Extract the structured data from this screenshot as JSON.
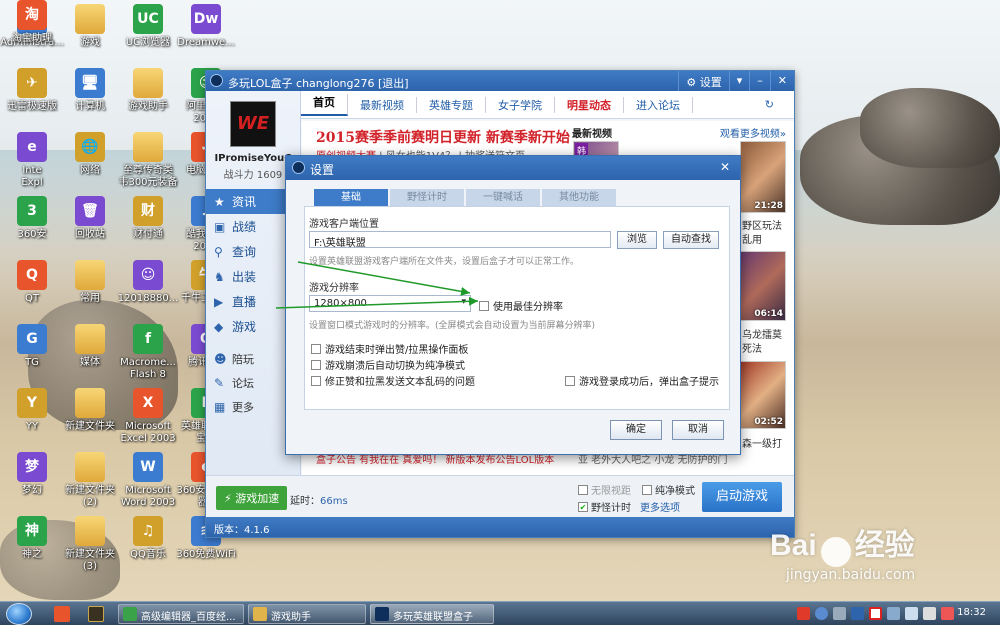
{
  "desktop": {
    "icons": [
      {
        "label": "Administra...",
        "glyph": "👤"
      },
      {
        "label": "游戏",
        "glyph": ""
      },
      {
        "label": "UC浏览器",
        "glyph": "UC"
      },
      {
        "label": "Dreamwe...",
        "glyph": "Dw"
      },
      {
        "label": "迅雷极速版",
        "glyph": "✈"
      },
      {
        "label": "计算机",
        "glyph": "🖥"
      },
      {
        "label": "游戏助手",
        "glyph": ""
      },
      {
        "label": "阿里旺旺\n2013",
        "glyph": "☺"
      },
      {
        "label": "Inte\nExpl",
        "glyph": "e"
      },
      {
        "label": "网络",
        "glyph": "🌐"
      },
      {
        "label": "至尊传奇类\n韦300元装备",
        "glyph": ""
      },
      {
        "label": "电脑管家",
        "glyph": "✓"
      },
      {
        "label": "360安",
        "glyph": "3"
      },
      {
        "label": "回收站",
        "glyph": "🗑"
      },
      {
        "label": "财付通",
        "glyph": "财"
      },
      {
        "label": "酷我音乐\n2014",
        "glyph": "♪"
      },
      {
        "label": "QT",
        "glyph": "Q"
      },
      {
        "label": "常用",
        "glyph": ""
      },
      {
        "label": "12018880...",
        "glyph": "☺"
      },
      {
        "label": "千牛工作台",
        "glyph": "牛"
      },
      {
        "label": "TG",
        "glyph": "G"
      },
      {
        "label": "媒体",
        "glyph": ""
      },
      {
        "label": "Macrome...\nFlash 8",
        "glyph": "f"
      },
      {
        "label": "腾讯QQ",
        "glyph": "Q"
      },
      {
        "label": "YY",
        "glyph": "Y"
      },
      {
        "label": "新建文件夹",
        "glyph": ""
      },
      {
        "label": "Microsoft\nExcel 2003",
        "glyph": "X"
      },
      {
        "label": "英雄联盟盒\n宝箱",
        "glyph": "L"
      },
      {
        "label": "梦幻",
        "glyph": "梦"
      },
      {
        "label": "新建文件夹\n(2)",
        "glyph": ""
      },
      {
        "label": "Microsoft\nWord 2003",
        "glyph": "W"
      },
      {
        "label": "360安全浏览\n器7",
        "glyph": "e"
      },
      {
        "label": "神之",
        "glyph": "神"
      },
      {
        "label": "新建文件夹\n(3)",
        "glyph": ""
      },
      {
        "label": "QQ音乐",
        "glyph": "♫"
      },
      {
        "label": "360免费WiFi",
        "glyph": "≋"
      },
      {
        "label": "淘宝助理",
        "glyph": "淘"
      }
    ]
  },
  "box": {
    "title": "多玩LOL盒子    changlong276 [退出]",
    "win_buttons": [
      "⚙ 设置",
      "▾",
      "–",
      "✕"
    ],
    "nav": [
      "首页",
      "最新视频",
      "英雄专题",
      "女子学院",
      "明星动态",
      "进入论坛"
    ],
    "refresh": "↻",
    "avatar_text": "WE",
    "username": "IPromiseYouC",
    "power": "战斗力 1609",
    "sidebar": [
      {
        "icon": "★",
        "label": "资讯"
      },
      {
        "icon": "▣",
        "label": "战绩"
      },
      {
        "icon": "⚲",
        "label": "查询"
      },
      {
        "icon": "♞",
        "label": "出装"
      },
      {
        "icon": "▶",
        "label": "直播"
      },
      {
        "icon": "◆",
        "label": "游戏"
      }
    ],
    "sidebar_small": [
      {
        "icon": "☻",
        "label": "陪玩"
      },
      {
        "icon": "✎",
        "label": "论坛"
      },
      {
        "icon": "▦",
        "label": "更多"
      }
    ],
    "headline": "2015赛季季前赛明日更新  新赛季新开始",
    "subline_red": "原创视频大赛",
    "subline_rest": " | 风女也能1V4？ | 抽奖送符文页",
    "videos_head": "最新视频",
    "videos_more": "观看更多视频»",
    "thumb_tag": "韩",
    "durations": [
      "21:28",
      "06:14",
      "02:52"
    ],
    "video_texts": [
      "野区玩法",
      "乱用",
      "乌龙擂莫",
      "死法",
      "森一级打"
    ],
    "bottom_news": "盒子公告    有我在在 真爱吗！  新版本发布公告LOL版本",
    "bottom_caption": "亚  老外大人吧之    小龙  无防护的门",
    "accel": "游戏加速",
    "latency_label": "延时：",
    "latency_val": "66ms",
    "opt_nolimit": "无限视距",
    "opt_pure": "纯净模式",
    "opt_timer": "野怪计时",
    "more_opts": "更多选项",
    "start": "启动游戏",
    "version": "版本：4.1.6"
  },
  "dialog": {
    "title": "设置",
    "close": "✕",
    "tabs": [
      "基础",
      "野怪计时",
      "一键喊话",
      "其他功能"
    ],
    "path_label": "游戏客户端位置",
    "path_value": "F:\\英雄联盟",
    "browse": "浏览",
    "autofind": "自动查找",
    "path_hint": "设置英雄联盟游戏客户端所在文件夹，设置后盒子才可以正常工作。",
    "res_label": "游戏分辨率",
    "res_value": "1280×800",
    "best_res": "使用最佳分辨率",
    "res_hint": "设置窗口模式游戏时的分辨率。(全屏模式会自动设置为当前屏幕分辨率)",
    "opt1": "游戏结束时弹出赞/拉黑操作面板",
    "opt2": "游戏崩溃后自动切换为纯净模式",
    "opt3": "修正赞和拉黑发送文本乱码的问题",
    "opt4": "游戏登录成功后，弹出盒子提示",
    "ok": "确定",
    "cancel": "取消"
  },
  "watermark": {
    "brand_left": "Bai",
    "brand_right": "经验",
    "url": "jingyan.baidu.com"
  },
  "taskbar": {
    "tasks": [
      "高级编辑器_百度经...",
      "游戏助手",
      "多玩英雄联盟盒子"
    ],
    "clock": "18:32"
  }
}
